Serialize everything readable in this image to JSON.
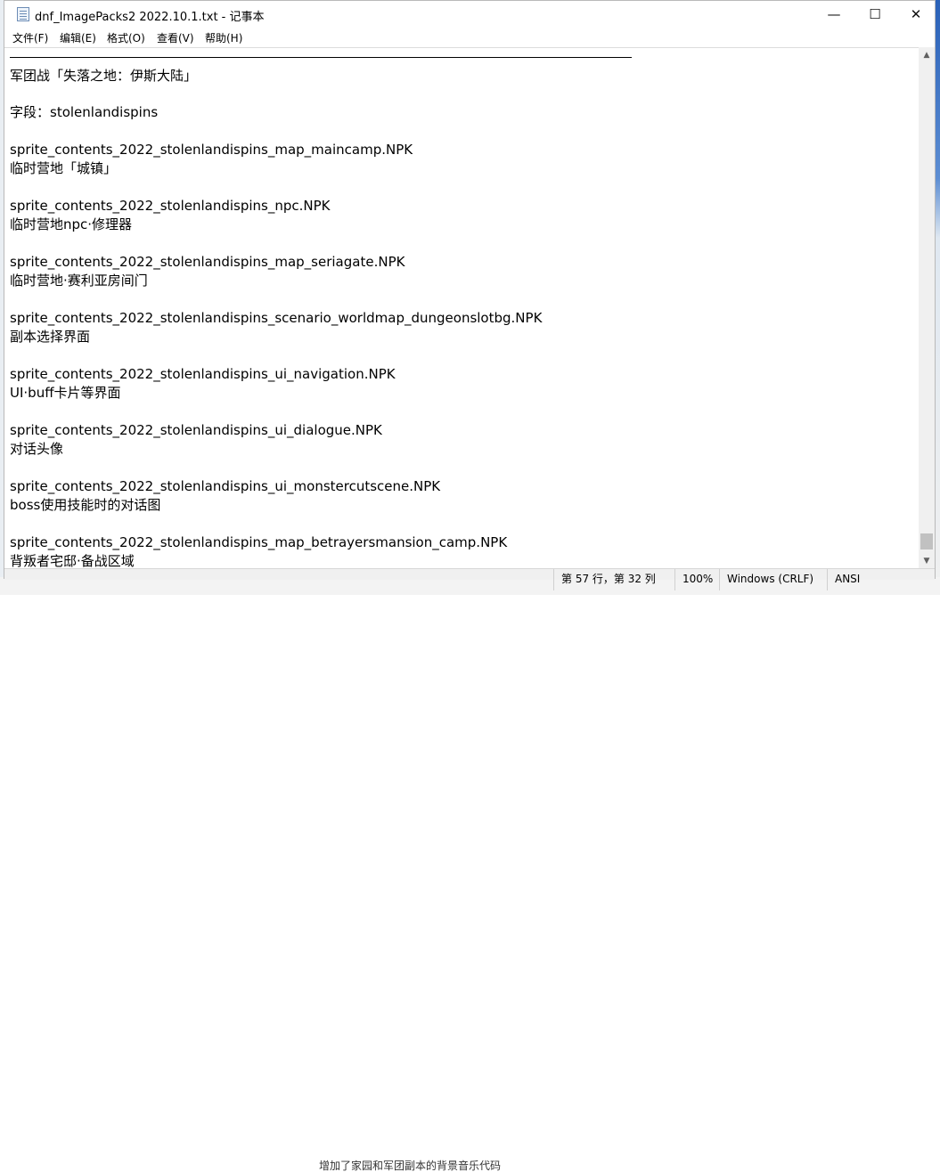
{
  "window": {
    "title": "dnf_ImagePacks2 2022.10.1.txt - 记事本",
    "minimize_glyph": "—",
    "maximize_glyph": "☐",
    "close_glyph": "✕"
  },
  "menu": {
    "items": [
      {
        "label": "文件(F)"
      },
      {
        "label": "编辑(E)"
      },
      {
        "label": "格式(O)"
      },
      {
        "label": "查看(V)"
      },
      {
        "label": "帮助(H)"
      }
    ]
  },
  "editor": {
    "lines": [
      "军团战「失落之地：伊斯大陆」",
      "字段：stolenlandispins",
      "sprite_contents_2022_stolenlandispins_map_maincamp.NPK",
      "临时营地「城镇」",
      "sprite_contents_2022_stolenlandispins_npc.NPK",
      "临时营地npc·修理器",
      "sprite_contents_2022_stolenlandispins_map_seriagate.NPK",
      "临时营地·赛利亚房间门",
      "sprite_contents_2022_stolenlandispins_scenario_worldmap_dungeonslotbg.NPK",
      "副本选择界面",
      "sprite_contents_2022_stolenlandispins_ui_navigation.NPK",
      "UI·buff卡片等界面",
      "sprite_contents_2022_stolenlandispins_ui_dialogue.NPK",
      "对话头像",
      "sprite_contents_2022_stolenlandispins_ui_monstercutscene.NPK",
      "boss使用技能时的对话图",
      "sprite_contents_2022_stolenlandispins_map_betrayersmansion_camp.NPK",
      "背叛者宅邸·备战区域"
    ]
  },
  "scrollbar": {
    "up_glyph": "▲",
    "down_glyph": "▼",
    "position_fraction": 0.96
  },
  "status": {
    "position": "第 57 行，第 32 列",
    "zoom": "100%",
    "line_ending": "Windows (CRLF)",
    "encoding": "ANSI"
  },
  "background": {
    "bottom_text": "增加了家园和军团副本的背景音乐代码"
  }
}
